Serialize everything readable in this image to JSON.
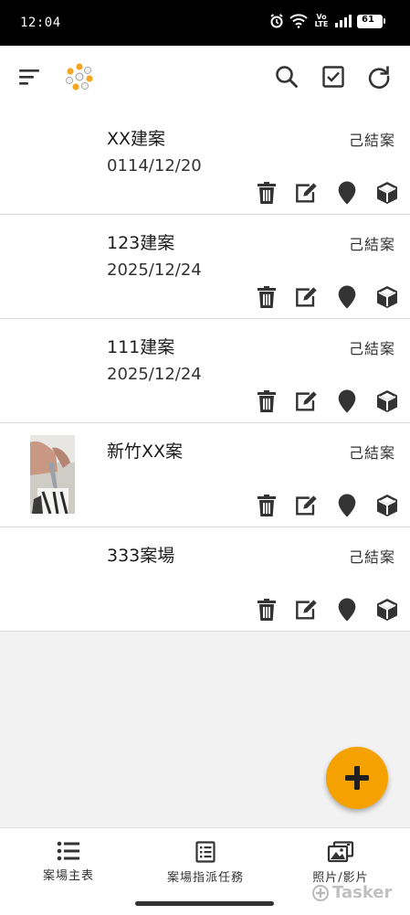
{
  "status_bar": {
    "time": "12:04",
    "network": "Vo LTE",
    "battery": "61"
  },
  "app_bar": {
    "menu_icon": "sort-menu-icon",
    "logo_icon": "flower-logo-icon",
    "search_icon": "search-icon",
    "check_icon": "checkbox-icon",
    "refresh_icon": "refresh-icon"
  },
  "projects": [
    {
      "title": "XX建案",
      "date": "0114/12/20",
      "status": "己結案",
      "has_thumbnail": false
    },
    {
      "title": "123建案",
      "date": "2025/12/24",
      "status": "己結案",
      "has_thumbnail": false
    },
    {
      "title": "111建案",
      "date": "2025/12/24",
      "status": "己結案",
      "has_thumbnail": false
    },
    {
      "title": "新竹XX案",
      "date": "",
      "status": "己結案",
      "has_thumbnail": true
    },
    {
      "title": "333案場",
      "date": "",
      "status": "己結案",
      "has_thumbnail": false
    }
  ],
  "row_actions": [
    "trash-icon",
    "edit-icon",
    "location-pin-icon",
    "box-icon"
  ],
  "fab": {
    "icon": "plus-icon",
    "color": "#f5a100"
  },
  "bottom_nav": [
    {
      "label": "案場主表",
      "icon": "list-icon"
    },
    {
      "label": "案場指派任務",
      "icon": "task-list-icon"
    },
    {
      "label": "照片/影片",
      "icon": "photos-icon"
    }
  ],
  "watermark": "Tasker"
}
